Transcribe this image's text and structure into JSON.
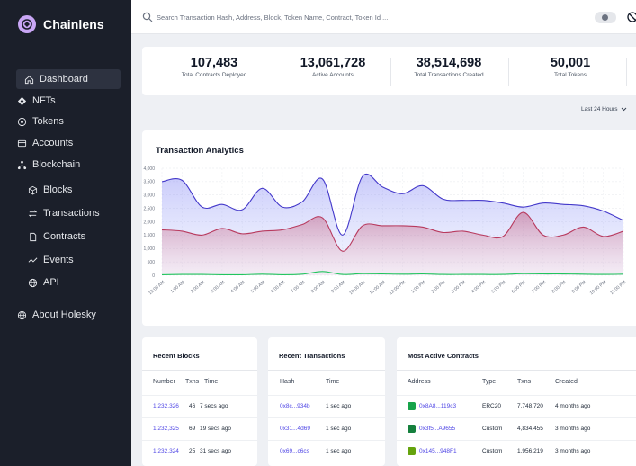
{
  "brand": {
    "name": "Chainlens"
  },
  "nav": [
    {
      "label": "Dashboard",
      "icon": "home-icon",
      "active": true
    },
    {
      "label": "NFTs",
      "icon": "nft-icon"
    },
    {
      "label": "Tokens",
      "icon": "token-icon"
    },
    {
      "label": "Accounts",
      "icon": "wallet-icon"
    },
    {
      "label": "Blockchain",
      "icon": "blockchain-icon"
    },
    {
      "label": "Blocks",
      "icon": "cube-icon",
      "sub": true
    },
    {
      "label": "Transactions",
      "icon": "transfer-icon",
      "sub": true
    },
    {
      "label": "Contracts",
      "icon": "document-icon",
      "sub": true
    },
    {
      "label": "Events",
      "icon": "activity-icon",
      "sub": true
    },
    {
      "label": "API",
      "icon": "globe-icon",
      "sub": true
    },
    {
      "label": "About Holesky",
      "icon": "globe-icon"
    }
  ],
  "search": {
    "placeholder": "Search Transaction Hash, Address, Block, Token Name, Contract, Token Id ..."
  },
  "stats": [
    {
      "value": "107,483",
      "label": "Total Contracts Deployed"
    },
    {
      "value": "13,061,728",
      "label": "Active Accounts"
    },
    {
      "value": "38,514,698",
      "label": "Total Transactions Created"
    },
    {
      "value": "50,001",
      "label": "Total Tokens"
    }
  ],
  "range": {
    "label": "Last 24 Hours"
  },
  "chart": {
    "title": "Transaction Analytics",
    "colors": {
      "blue": "#4338ca",
      "red": "#b83a5e",
      "green": "#22c55e"
    }
  },
  "chart_data": {
    "type": "area",
    "title": "Transaction Analytics",
    "ylim": [
      0,
      4000
    ],
    "yticks": [
      "0",
      "500",
      "1,000",
      "1,500",
      "2,000",
      "2,500",
      "3,000",
      "3,500",
      "4,000"
    ],
    "grid": true,
    "x": [
      "12:00 AM",
      "1:00 AM",
      "2:00 AM",
      "3:00 AM",
      "4:00 AM",
      "5:00 AM",
      "6:00 AM",
      "7:00 AM",
      "8:00 AM",
      "9:00 AM",
      "10:00 AM",
      "11:00 AM",
      "12:00 PM",
      "1:00 PM",
      "2:00 PM",
      "3:00 PM",
      "4:00 PM",
      "5:00 PM",
      "6:00 PM",
      "7:00 PM",
      "8:00 PM",
      "9:00 PM",
      "10:00 PM",
      "11:00 PM"
    ],
    "series": [
      {
        "color": "#4338ca",
        "values": [
          3500,
          3550,
          2550,
          2650,
          2450,
          3250,
          2550,
          2750,
          3600,
          1500,
          3700,
          3300,
          3050,
          3350,
          2850,
          2800,
          2800,
          2700,
          2550,
          2700,
          2650,
          2600,
          2400,
          2050
        ]
      },
      {
        "color": "#b83a5e",
        "values": [
          1700,
          1650,
          1500,
          1750,
          1550,
          1650,
          1700,
          1900,
          2150,
          900,
          1850,
          1850,
          1850,
          1800,
          1600,
          1650,
          1500,
          1450,
          2350,
          1500,
          1500,
          1800,
          1450,
          1650
        ]
      },
      {
        "color": "#22c55e",
        "values": [
          20,
          30,
          30,
          20,
          20,
          40,
          20,
          40,
          140,
          30,
          60,
          50,
          40,
          50,
          30,
          30,
          30,
          30,
          60,
          50,
          50,
          40,
          30,
          40
        ]
      }
    ]
  },
  "recent_blocks": {
    "title": "Recent Blocks",
    "headers": [
      "Number",
      "Txns",
      "Time"
    ],
    "rows": [
      [
        "1,232,326",
        "46",
        "7 secs ago"
      ],
      [
        "1,232,325",
        "69",
        "19 secs ago"
      ],
      [
        "1,232,324",
        "25",
        "31 secs ago"
      ]
    ]
  },
  "recent_transactions": {
    "title": "Recent Transactions",
    "headers": [
      "Hash",
      "Time"
    ],
    "rows": [
      [
        "0x8c...934b",
        "1 sec ago"
      ],
      [
        "0x31...4d69",
        "1 sec ago"
      ],
      [
        "0x69...c6cs",
        "1 sec ago"
      ]
    ]
  },
  "active_contracts": {
    "title": "Most Active Contracts",
    "headers": [
      "Address",
      "Type",
      "Txns",
      "Created"
    ],
    "rows": [
      [
        "0x8A8...119c3",
        "ERC20",
        "7,748,720",
        "4 months ago"
      ],
      [
        "0x3f5...A9655",
        "Custom",
        "4,834,455",
        "3 months ago"
      ],
      [
        "0x145...948F1",
        "Custom",
        "1,956,219",
        "3 months ago"
      ]
    ],
    "icon_colors": [
      "#16a34a",
      "#15803d",
      "#65a30d"
    ]
  }
}
